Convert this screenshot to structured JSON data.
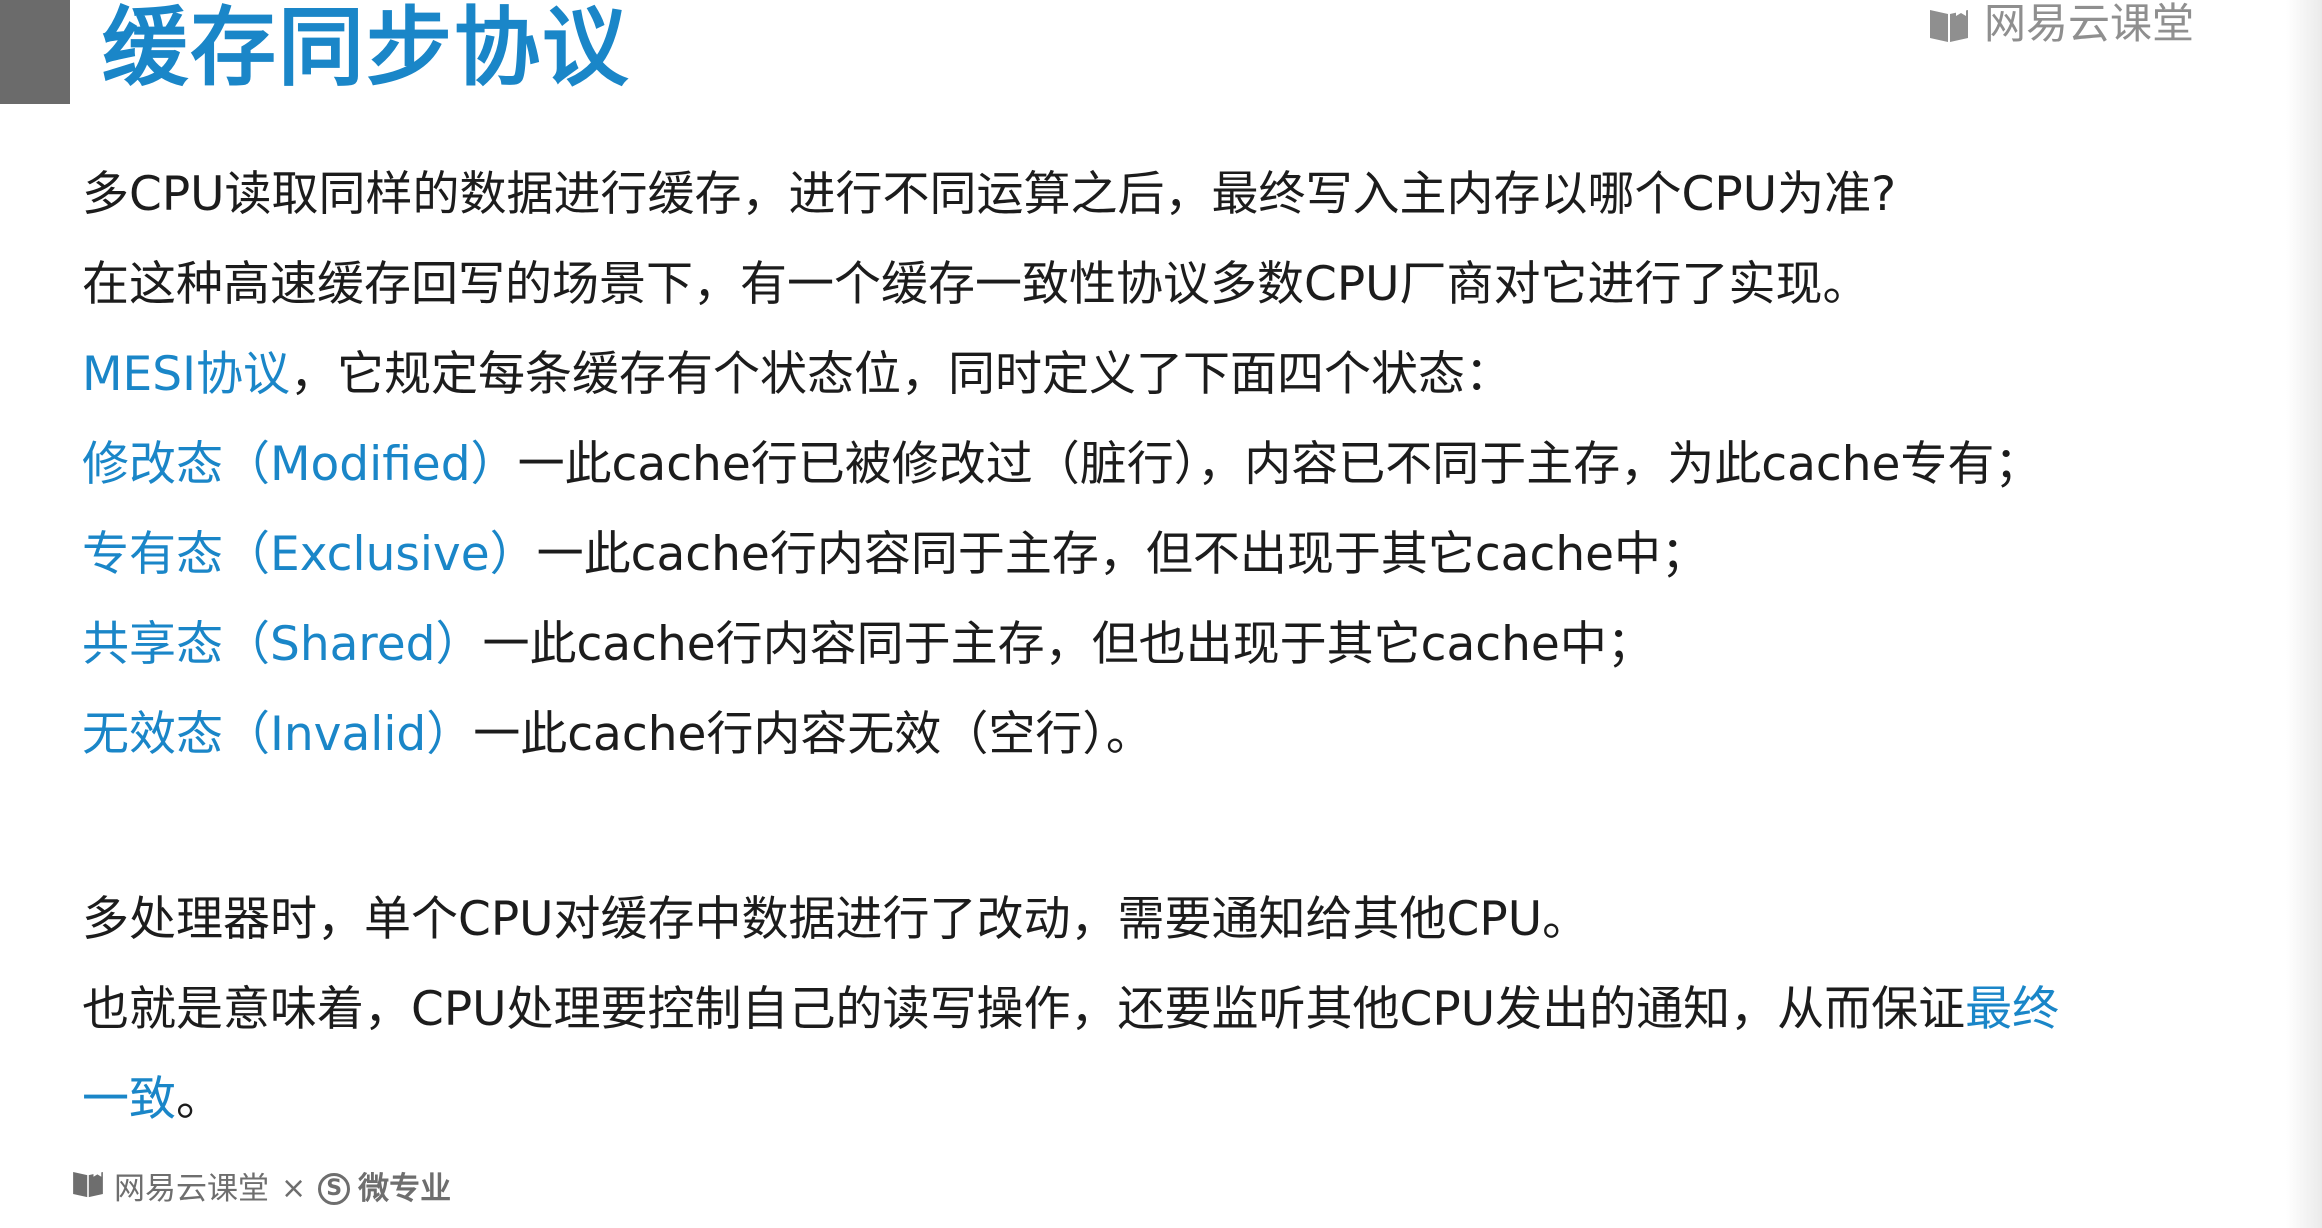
{
  "title": "缓存同步协议",
  "brand": {
    "top_text": "网易云课堂",
    "bottom_left": "网易云课堂",
    "bottom_times": "×",
    "bottom_s": "S",
    "bottom_right": "微专业"
  },
  "colors": {
    "accent": "#1a86c8",
    "text": "#1c1c1c",
    "title_bar": "#6b6b6b",
    "brand_gray": "#8f8f8f"
  },
  "lines": {
    "l1": "多CPU读取同样的数据进行缓存，进行不同运算之后，最终写入主内存以哪个CPU为准?",
    "l2": "在这种高速缓存回写的场景下，有一个缓存一致性协议多数CPU厂商对它进行了实现。",
    "l3_hl": "MESI协议",
    "l3_rest": "，它规定每条缓存有个状态位，同时定义了下面四个状态：",
    "l4_hl": "修改态（Modified）",
    "l4_rest": "一此cache行已被修改过（脏行），内容已不同于主存，为此cache专有；",
    "l5_hl": "专有态（Exclusive）",
    "l5_rest": "一此cache行内容同于主存，但不出现于其它cache中；",
    "l6_hl": "共享态（Shared）",
    "l6_rest": "一此cache行内容同于主存，但也出现于其它cache中；",
    "l7_hl": "无效态（Invalid）",
    "l7_rest": "一此cache行内容无效（空行）。",
    "l8": "多处理器时，单个CPU对缓存中数据进行了改动，需要通知给其他CPU。",
    "l9_pre": "也就是意味着，CPU处理要控制自己的读写操作，还要监听其他CPU发出的通知，从而保证",
    "l9_hl": "最终",
    "l10_hl": "一致",
    "l10_rest": "。"
  }
}
